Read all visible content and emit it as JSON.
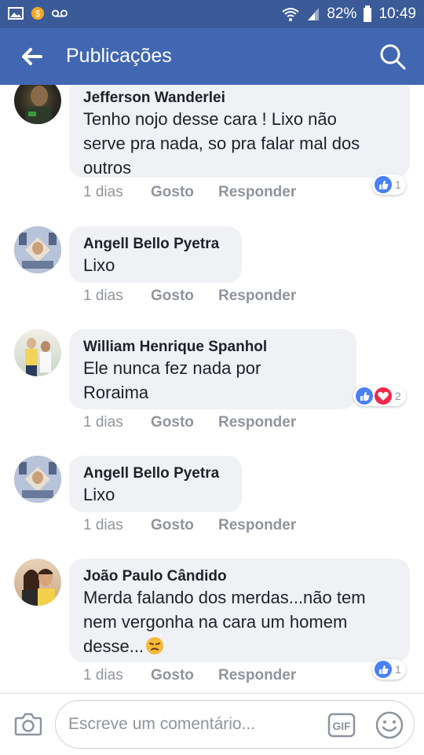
{
  "status_bar": {
    "battery": "82%",
    "time": "10:49"
  },
  "app_bar": {
    "title": "Publicações"
  },
  "comments": [
    {
      "author": "Jefferson Wanderlei",
      "lines": [
        "Tenho nojo desse cara ! Lixo  não",
        "serve pra nada, so pra falar mal dos",
        "outros"
      ],
      "time": "1 dias",
      "like": "Gosto",
      "reply": "Responder",
      "reaction_count": "1",
      "reactions": [
        "like"
      ]
    },
    {
      "author": "Angell Bello Pyetra",
      "lines": [
        "Lixo"
      ],
      "time": "1 dias",
      "like": "Gosto",
      "reply": "Responder",
      "reaction_count": "",
      "reactions": []
    },
    {
      "author": "William Henrique Spanhol",
      "lines": [
        "Ele nunca fez nada por",
        "Roraima"
      ],
      "time": "1 dias",
      "like": "Gosto",
      "reply": "Responder",
      "reaction_count": "2",
      "reactions": [
        "like",
        "love"
      ]
    },
    {
      "author": "Angell Bello Pyetra",
      "lines": [
        "Lixo"
      ],
      "time": "1 dias",
      "like": "Gosto",
      "reply": "Responder",
      "reaction_count": "",
      "reactions": []
    },
    {
      "author": "João Paulo Cândido",
      "lines": [
        "Merda falando dos merdas...não tem",
        "nem vergonha na cara um homem",
        "desse..."
      ],
      "time": "1 dias",
      "like": "Gosto",
      "reply": "Responder",
      "reaction_count": "1",
      "reactions": [
        "like"
      ]
    }
  ],
  "composer": {
    "placeholder": "Escreve um comentário...",
    "gif_label": "GIF"
  },
  "colors": {
    "header": "#4267b2",
    "status_bar": "#3b5a98",
    "bubble": "#f0f1f4",
    "like": "#4a80f5",
    "love": "#f0284a"
  }
}
